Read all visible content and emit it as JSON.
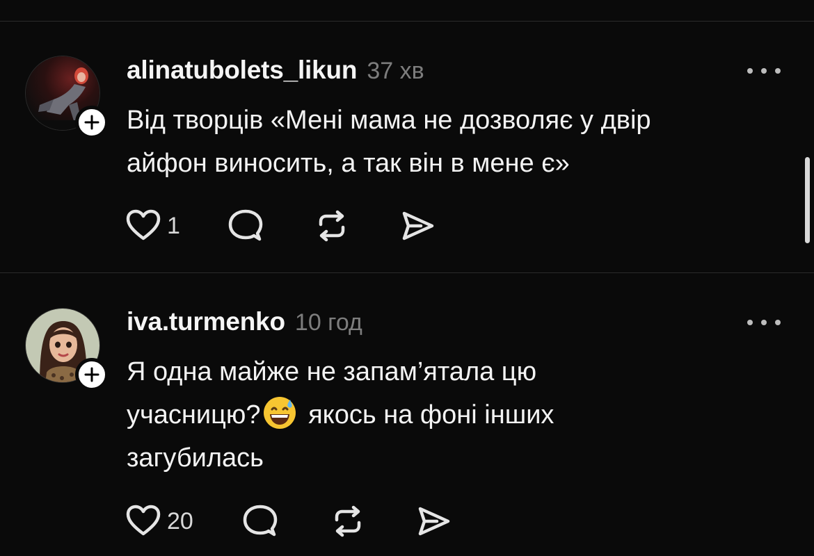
{
  "posts": [
    {
      "username": "alinatubolets_likun",
      "time": "37 хв",
      "text_lines": [
        "Від творців «Мені мама не дозволяє у двір",
        "айфон виносить, а так він в мене є»"
      ],
      "likes": "1",
      "avatar_icon": "avatar-photo-dark-red",
      "follow_icon": "plus-icon"
    },
    {
      "username": "iva.turmenko",
      "time": "10 год",
      "text_lines": [
        "Я одна майже не запам’ятала цю",
        "учасницю?",
        "якось на фоні інших",
        "загубилась"
      ],
      "emoji": "grinning-face-with-sweat",
      "likes": "20",
      "avatar_icon": "avatar-cartoon-woman",
      "follow_icon": "plus-icon"
    }
  ],
  "action_icons": [
    "heart-icon",
    "comment-icon",
    "repost-icon",
    "share-icon"
  ],
  "colors": {
    "background": "#0a0a0a",
    "text": "#f3f3f3",
    "muted": "#7d7d7d",
    "divider": "#2b2b2b"
  }
}
